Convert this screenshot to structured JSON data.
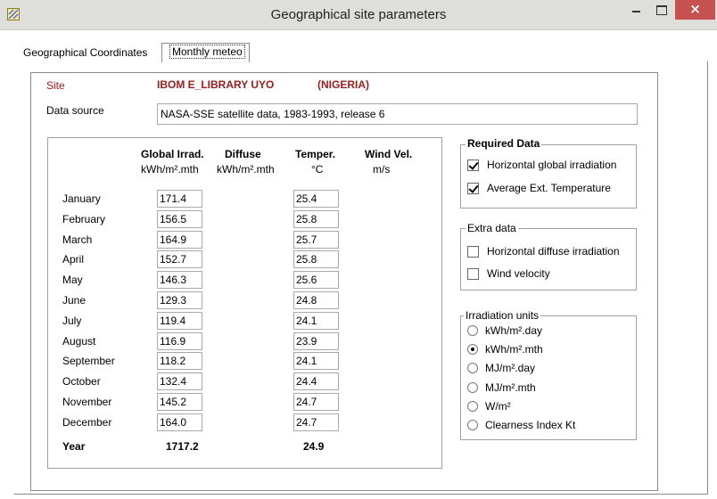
{
  "window": {
    "title": "Geographical site parameters",
    "close_glyph": "×"
  },
  "tabs": [
    {
      "label": "Geographical Coordinates"
    },
    {
      "label": "Monthly meteo"
    }
  ],
  "site": {
    "label": "Site",
    "name": "IBOM E_LIBRARY UYO",
    "country": "(NIGERIA)"
  },
  "data_source": {
    "label": "Data source",
    "value": "NASA-SSE satellite data, 1983-1993, release 6"
  },
  "table": {
    "headers": {
      "global": {
        "title": "Global Irrad.",
        "unit": "kWh/m².mth"
      },
      "diffuse": {
        "title": "Diffuse",
        "unit": "kWh/m².mth"
      },
      "temp": {
        "title": "Temper.",
        "unit": "°C"
      },
      "wind": {
        "title": "Wind Vel.",
        "unit": "m/s"
      }
    },
    "rows": [
      {
        "month": "January",
        "global": "171.4",
        "temp": "25.4"
      },
      {
        "month": "February",
        "global": "156.5",
        "temp": "25.8"
      },
      {
        "month": "March",
        "global": "164.9",
        "temp": "25.7"
      },
      {
        "month": "April",
        "global": "152.7",
        "temp": "25.8"
      },
      {
        "month": "May",
        "global": "146.3",
        "temp": "25.6"
      },
      {
        "month": "June",
        "global": "129.3",
        "temp": "24.8"
      },
      {
        "month": "July",
        "global": "119.4",
        "temp": "24.1"
      },
      {
        "month": "August",
        "global": "116.9",
        "temp": "23.9"
      },
      {
        "month": "September",
        "global": "118.2",
        "temp": "24.1"
      },
      {
        "month": "October",
        "global": "132.4",
        "temp": "24.4"
      },
      {
        "month": "November",
        "global": "145.2",
        "temp": "24.7"
      },
      {
        "month": "December",
        "global": "164.0",
        "temp": "24.7"
      }
    ],
    "year": {
      "label": "Year",
      "global": "1717.2",
      "temp": "24.9"
    }
  },
  "required_data": {
    "title": "Required Data",
    "options": [
      {
        "label": "Horizontal global irradiation",
        "checked": true
      },
      {
        "label": "Average Ext. Temperature",
        "checked": true
      }
    ]
  },
  "extra_data": {
    "title": "Extra data",
    "options": [
      {
        "label": "Horizontal diffuse irradiation",
        "checked": false
      },
      {
        "label": "Wind velocity",
        "checked": false
      }
    ]
  },
  "irradiation_units": {
    "title": "Irradiation units",
    "options": [
      {
        "label": "kWh/m².day",
        "selected": false
      },
      {
        "label": "kWh/m².mth",
        "selected": true
      },
      {
        "label": "MJ/m².day",
        "selected": false
      },
      {
        "label": "MJ/m².mth",
        "selected": false
      },
      {
        "label": "W/m²",
        "selected": false
      },
      {
        "label": "Clearness Index Kt",
        "selected": false
      }
    ]
  }
}
